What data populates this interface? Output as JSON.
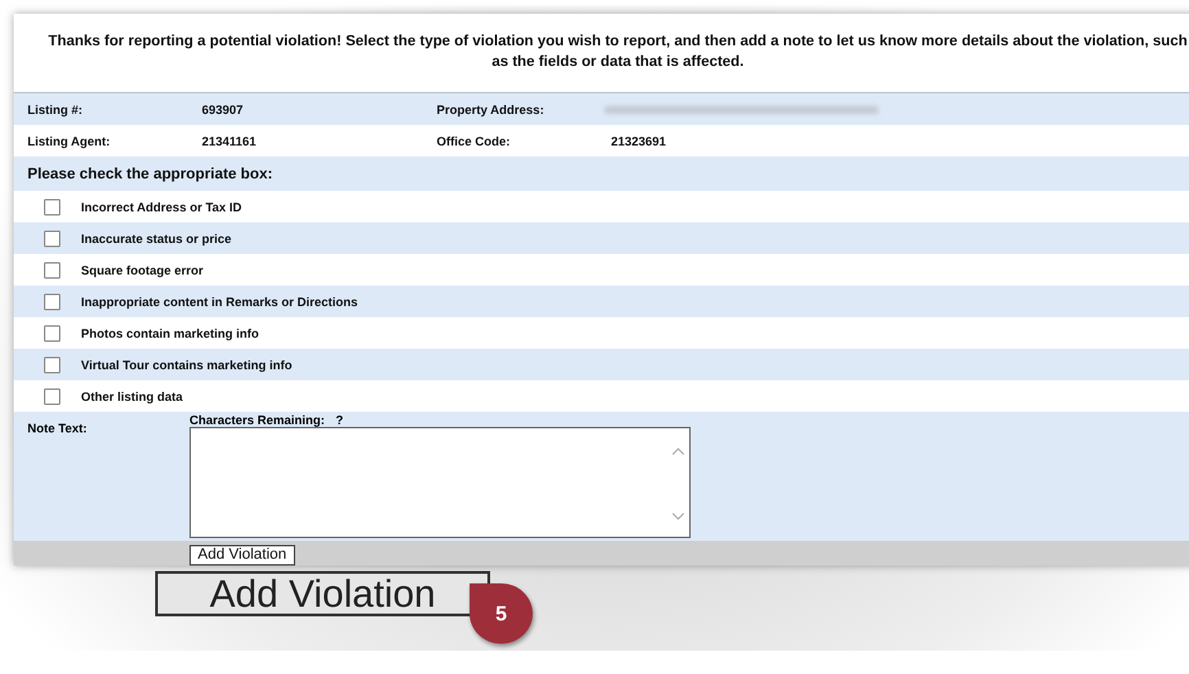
{
  "intro": "Thanks for reporting a potential violation! Select the type of violation you wish to report, and then add a note to let us know more details about the violation, such as the fields or data that is affected.",
  "info_rows": [
    {
      "label": "Listing #:",
      "value": "693907",
      "label_2": "Property Address:",
      "value_2_blurred": true
    },
    {
      "label": "Listing Agent:",
      "value": "21341161",
      "label_2": "Office Code:",
      "value_2": "21323691"
    }
  ],
  "check_heading": "Please check the appropriate box:",
  "options": [
    {
      "label": "Incorrect Address or Tax ID",
      "checked": false
    },
    {
      "label": "Inaccurate status or price",
      "checked": false
    },
    {
      "label": "Square footage error",
      "checked": false
    },
    {
      "label": "Inappropriate content in Remarks or Directions",
      "checked": false
    },
    {
      "label": "Photos contain marketing info",
      "checked": false
    },
    {
      "label": "Virtual Tour contains marketing info",
      "checked": false
    },
    {
      "label": "Other listing data",
      "checked": false
    }
  ],
  "note": {
    "label": "Note Text:",
    "counter_label": "Characters Remaining:",
    "counter_value": "?"
  },
  "button": "Add Violation",
  "callout": {
    "button": "Add Violation",
    "step": "5"
  }
}
